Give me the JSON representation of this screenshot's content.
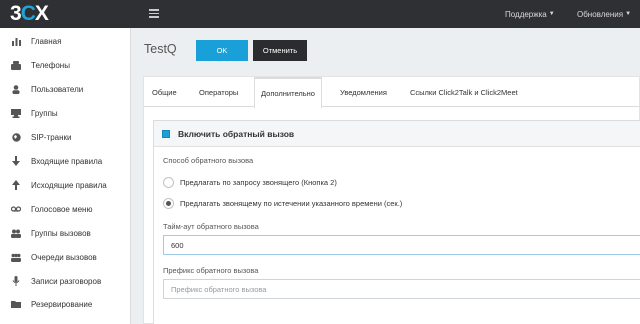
{
  "topbar": {
    "logo": {
      "part1": "3",
      "part2": "C",
      "part3": "X"
    },
    "support": "Поддержка",
    "updates": "Обновления"
  },
  "sidebar": {
    "items": [
      {
        "label": "Главная",
        "icon": "bar-chart-icon"
      },
      {
        "label": "Телефоны",
        "icon": "phone-icon"
      },
      {
        "label": "Пользователи",
        "icon": "user-icon"
      },
      {
        "label": "Группы",
        "icon": "groups-icon"
      },
      {
        "label": "SIP-транки",
        "icon": "globe-icon"
      },
      {
        "label": "Входящие правила",
        "icon": "arrow-down-icon"
      },
      {
        "label": "Исходящие правила",
        "icon": "arrow-up-icon"
      },
      {
        "label": "Голосовое меню",
        "icon": "voicemail-icon"
      },
      {
        "label": "Группы вызовов",
        "icon": "call-groups-icon"
      },
      {
        "label": "Очереди вызовов",
        "icon": "queue-icon"
      },
      {
        "label": "Записи разговоров",
        "icon": "microphone-icon"
      },
      {
        "label": "Резервирование",
        "icon": "folder-icon"
      }
    ]
  },
  "page": {
    "title": "TestQ",
    "ok_label": "OK",
    "cancel_label": "Отменить"
  },
  "tabs": [
    {
      "label": "Общие",
      "active": false
    },
    {
      "label": "Операторы",
      "active": false
    },
    {
      "label": "Дополнительно",
      "active": true
    },
    {
      "label": "Уведомления",
      "active": false
    },
    {
      "label": "Ссылки Click2Talk и Click2Meet",
      "active": false
    }
  ],
  "callback": {
    "enable_label": "Включить обратный вызов",
    "enabled": true,
    "method_label": "Способ обратного вызова",
    "option1": "Предлагать по запросу звонящего (Кнопка 2)",
    "option2": "Предлагать звонящему по истечении указанного времени (сек.)",
    "selected_option": 2,
    "timeout_label": "Тайм-аут обратного вызова",
    "timeout_value": "600",
    "prefix_label": "Префикс обратного вызова",
    "prefix_placeholder": "Префикс обратного вызова",
    "prefix_value": ""
  },
  "colors": {
    "accent": "#1aa0d8",
    "topbar": "#2f3033",
    "cancel": "#2b2c2f"
  }
}
